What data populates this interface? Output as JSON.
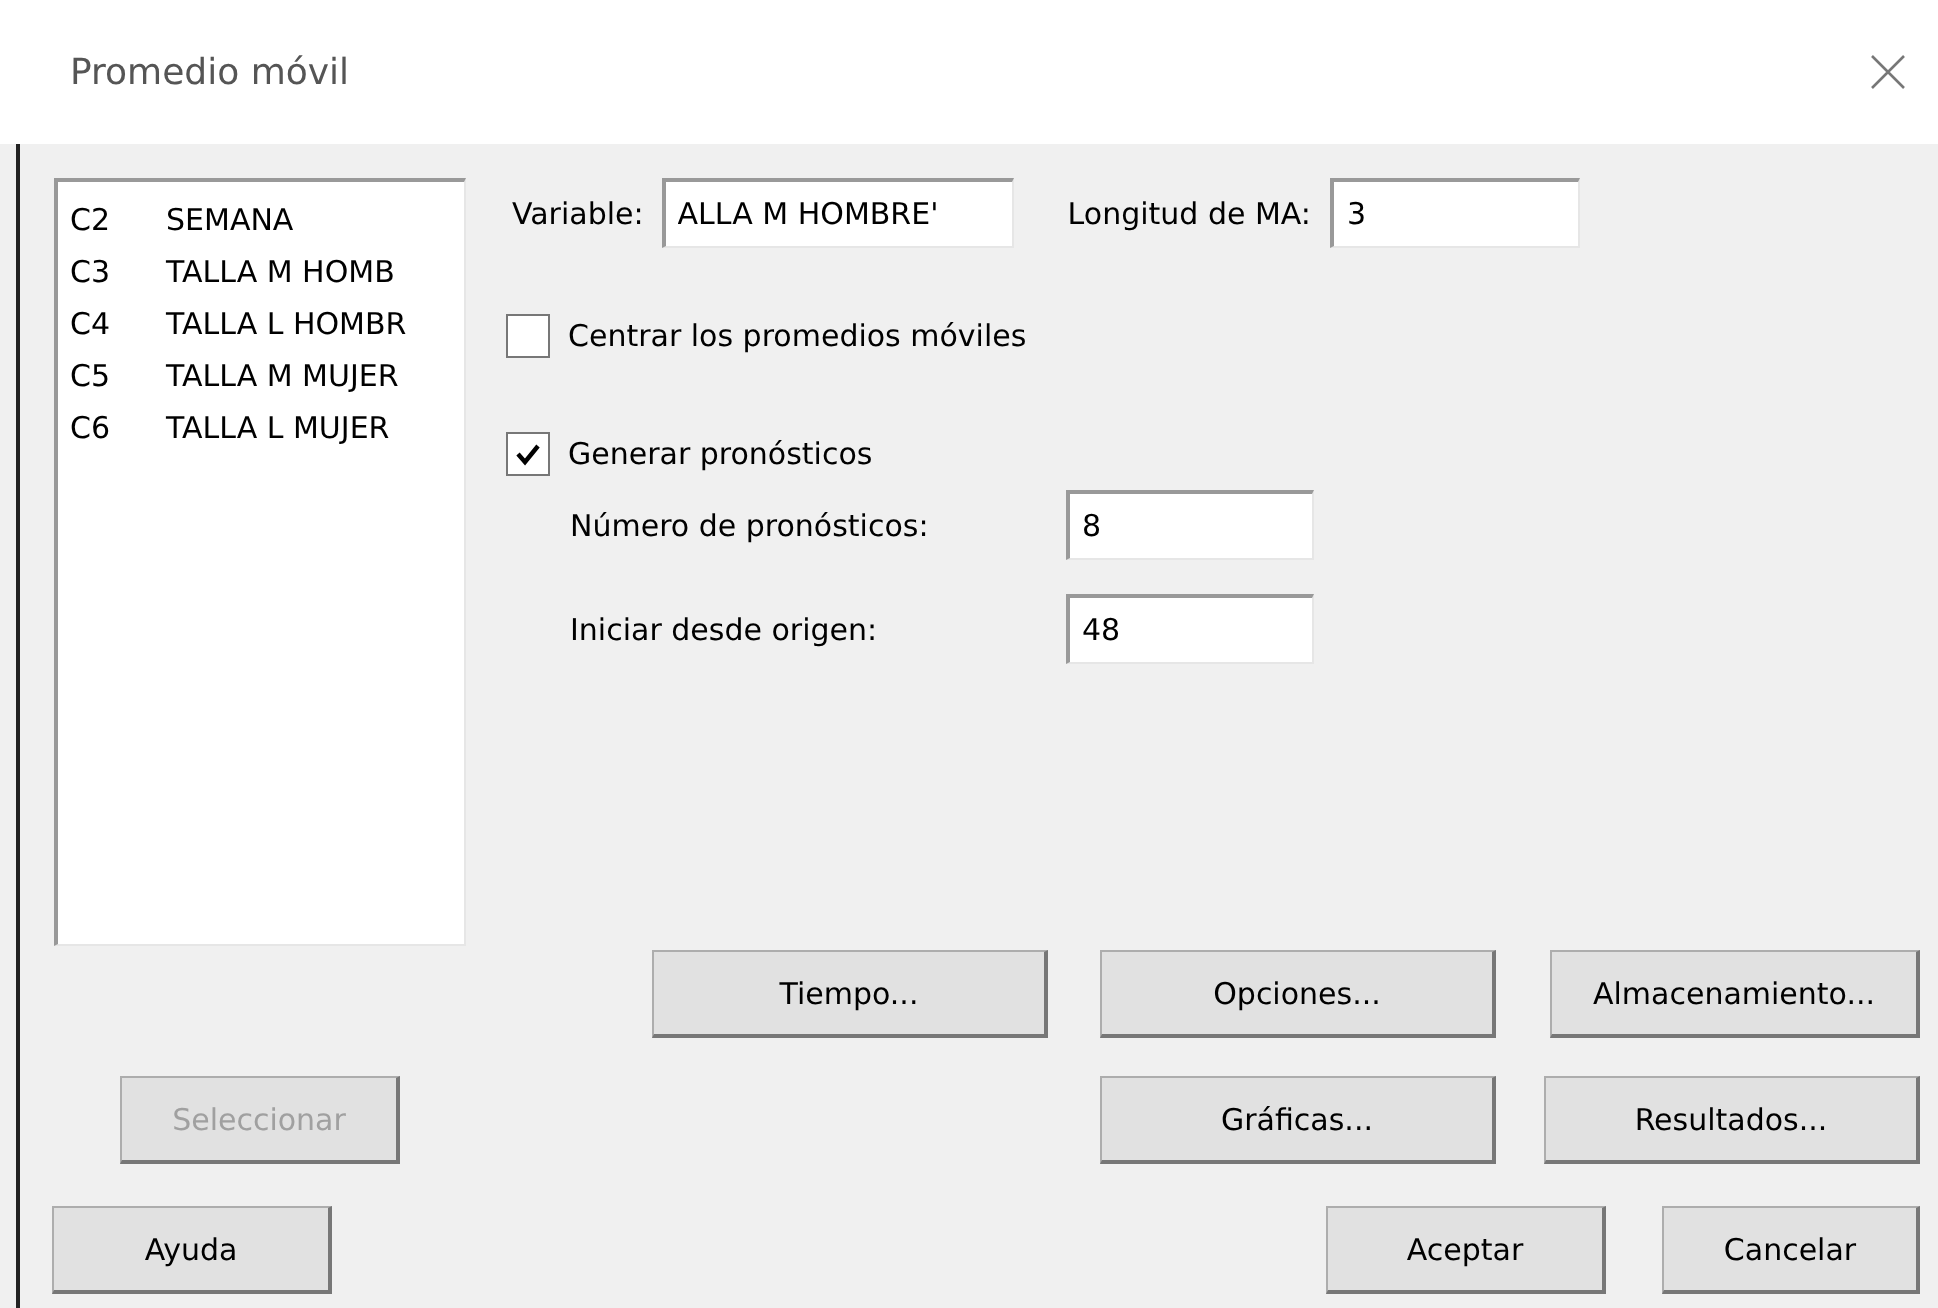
{
  "window": {
    "title": "Promedio móvil"
  },
  "variables": [
    {
      "code": "C2",
      "name": "SEMANA"
    },
    {
      "code": "C3",
      "name": "TALLA M HOMB"
    },
    {
      "code": "C4",
      "name": "TALLA L HOMBR"
    },
    {
      "code": "C5",
      "name": "TALLA M MUJER"
    },
    {
      "code": "C6",
      "name": "TALLA L MUJER"
    }
  ],
  "variable_field": {
    "label": "Variable:",
    "value": "ALLA M HOMBRE'"
  },
  "ma_length_field": {
    "label": "Longitud de MA:",
    "value": "3"
  },
  "center_checkbox": {
    "label": "Centrar los promedios móviles",
    "checked": false
  },
  "forecast_checkbox": {
    "label": "Generar pronósticos",
    "checked": true
  },
  "forecast_count_field": {
    "label": "Número de pronósticos:",
    "value": "8"
  },
  "origin_field": {
    "label": "Iniciar desde origen:",
    "value": "48"
  },
  "buttons_row_1": [
    {
      "label": "Tiempo...",
      "disabled": false
    },
    {
      "label": "Opciones...",
      "disabled": false
    },
    {
      "label": "Almacenamiento...",
      "disabled": false
    }
  ],
  "select_button": {
    "label": "Seleccionar",
    "disabled": true
  },
  "buttons_row_2": [
    {
      "label": "Gráficas...",
      "disabled": false
    },
    {
      "label": "Resultados...",
      "disabled": false
    }
  ],
  "help_button": {
    "label": "Ayuda",
    "disabled": false
  },
  "buttons_row_3": [
    {
      "label": "Aceptar",
      "disabled": false
    },
    {
      "label": "Cancelar",
      "disabled": false
    }
  ]
}
